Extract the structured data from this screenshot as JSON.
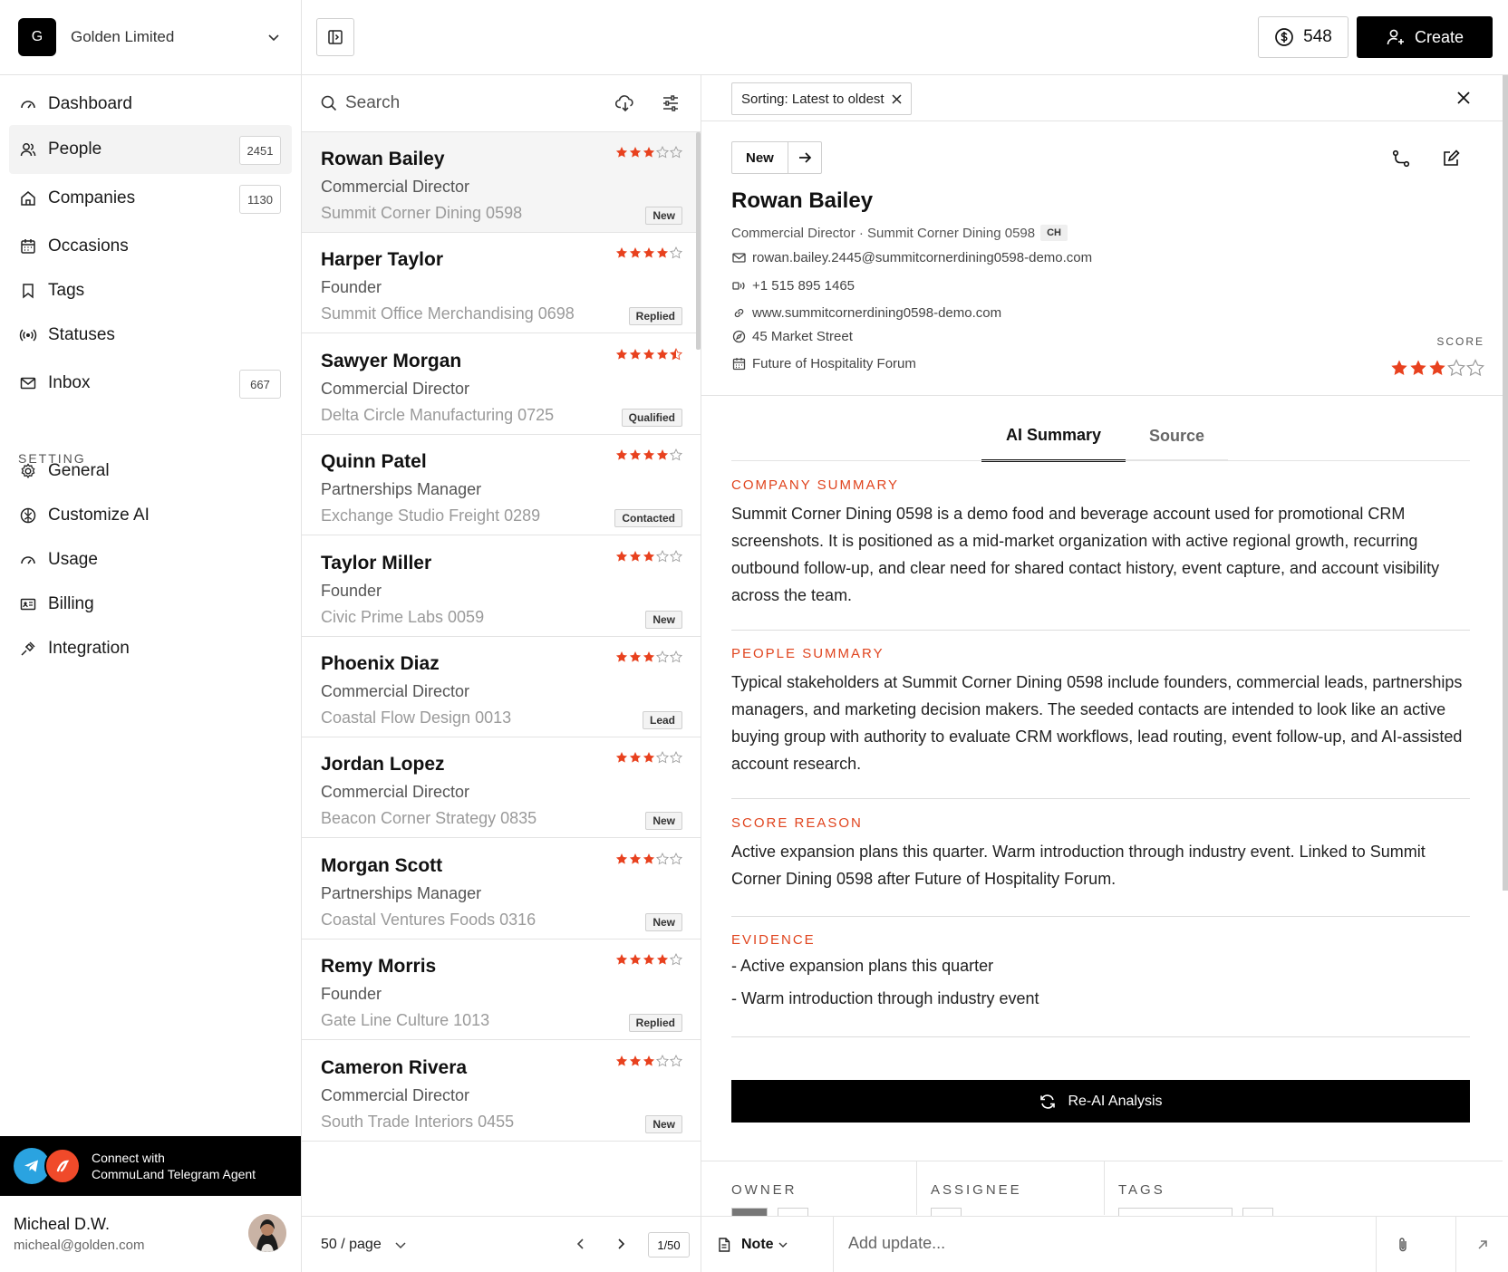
{
  "org": {
    "logo": "G",
    "name": "Golden Limited",
    "chevron_icon": "chevron-down-icon"
  },
  "nav": {
    "items": [
      {
        "label": "Dashboard",
        "icon": "gauge-icon",
        "count": ""
      },
      {
        "label": "People",
        "icon": "people-icon",
        "count": "2451",
        "active": true
      },
      {
        "label": "Companies",
        "icon": "home-icon",
        "count": "1130"
      },
      {
        "label": "Occasions",
        "icon": "calendar-icon",
        "count": ""
      },
      {
        "label": "Tags",
        "icon": "bookmark-icon",
        "count": ""
      },
      {
        "label": "Statuses",
        "icon": "broadcast-icon",
        "count": ""
      },
      {
        "label": "Inbox",
        "icon": "mail-icon",
        "count": "667"
      }
    ],
    "setting_heading": "SETTING",
    "settings": [
      {
        "label": "General",
        "icon": "gear-icon"
      },
      {
        "label": "Customize AI",
        "icon": "brain-icon"
      },
      {
        "label": "Usage",
        "icon": "gauge-icon"
      },
      {
        "label": "Billing",
        "icon": "id-card-icon"
      },
      {
        "label": "Integration",
        "icon": "plug-icon"
      }
    ]
  },
  "telegram": {
    "line1": "Connect with",
    "line2": "CommuLand Telegram Agent"
  },
  "user": {
    "name": "Micheal D.W.",
    "email": "micheal@golden.com"
  },
  "topbar": {
    "credits": "548",
    "create_label": "Create"
  },
  "list": {
    "search_placeholder": "Search",
    "people": [
      {
        "name": "Rowan Bailey",
        "role": "Commercial Director",
        "company": "Summit Corner Dining 0598",
        "status": "New",
        "rating": 3
      },
      {
        "name": "Harper Taylor",
        "role": "Founder",
        "company": "Summit Office Merchandising 0698",
        "status": "Replied",
        "rating": 4
      },
      {
        "name": "Sawyer Morgan",
        "role": "Commercial Director",
        "company": "Delta Circle Manufacturing 0725",
        "status": "Qualified",
        "rating": 4.5
      },
      {
        "name": "Quinn Patel",
        "role": "Partnerships Manager",
        "company": "Exchange Studio Freight 0289",
        "status": "Contacted",
        "rating": 4
      },
      {
        "name": "Taylor Miller",
        "role": "Founder",
        "company": "Civic Prime Labs 0059",
        "status": "New",
        "rating": 3
      },
      {
        "name": "Phoenix Diaz",
        "role": "Commercial Director",
        "company": "Coastal Flow Design 0013",
        "status": "Lead",
        "rating": 3
      },
      {
        "name": "Jordan Lopez",
        "role": "Commercial Director",
        "company": "Beacon Corner Strategy 0835",
        "status": "New",
        "rating": 3
      },
      {
        "name": "Morgan Scott",
        "role": "Partnerships Manager",
        "company": "Coastal Ventures Foods 0316",
        "status": "New",
        "rating": 3
      },
      {
        "name": "Remy Morris",
        "role": "Founder",
        "company": "Gate Line Culture 1013",
        "status": "Replied",
        "rating": 4
      },
      {
        "name": "Cameron Rivera",
        "role": "Commercial Director",
        "company": "South Trade Interiors 0455",
        "status": "New",
        "rating": 3
      }
    ],
    "page_size": "50 / page",
    "page_num": "1/50"
  },
  "detail": {
    "sort_chip": "Sorting: Latest to oldest",
    "status": "New",
    "name": "Rowan Bailey",
    "subtitle": "Commercial Director · Summit Corner Dining 0598",
    "country": "CH",
    "email": "rowan.bailey.2445@summitcornerdining0598-demo.com",
    "phone": "+1 515 895 1465",
    "website": "www.summitcornerdining0598-demo.com",
    "address": "45 Market Street",
    "event": "Future of Hospitality Forum",
    "score_label": "SCORE",
    "score": 3,
    "tabs": [
      "AI Summary",
      "Source"
    ],
    "company_summary_title": "COMPANY SUMMARY",
    "company_summary": "Summit Corner Dining 0598 is a demo food and beverage account used for promotional CRM screenshots. It is positioned as a mid-market organization with active regional growth, recurring outbound follow-up, and clear need for shared contact history, event capture, and account visibility across the team.",
    "people_summary_title": "PEOPLE SUMMARY",
    "people_summary": "Typical stakeholders at Summit Corner Dining 0598 include founders, commercial leads, partnerships managers, and marketing decision makers. The seeded contacts are intended to look like an active buying group with authority to evaluate CRM workflows, lead routing, event follow-up, and AI-assisted account research.",
    "score_reason_title": "SCORE REASON",
    "score_reason": "Active expansion plans this quarter. Warm introduction through industry event. Linked to Summit Corner Dining 0598 after Future of Hospitality Forum.",
    "evidence_title": "EVIDENCE",
    "evidence": [
      "- Active expansion plans this quarter",
      "- Warm introduction through industry event"
    ],
    "reanalysis_label": "Re-AI Analysis",
    "owner_label": "OWNER",
    "assignee_label": "ASSIGNEE",
    "tags_label": "TAGS"
  },
  "composer": {
    "type_label": "Note",
    "placeholder": "Add update..."
  },
  "colors": {
    "accent": "#e0441e",
    "star": "#e8411e",
    "black": "#000000"
  }
}
